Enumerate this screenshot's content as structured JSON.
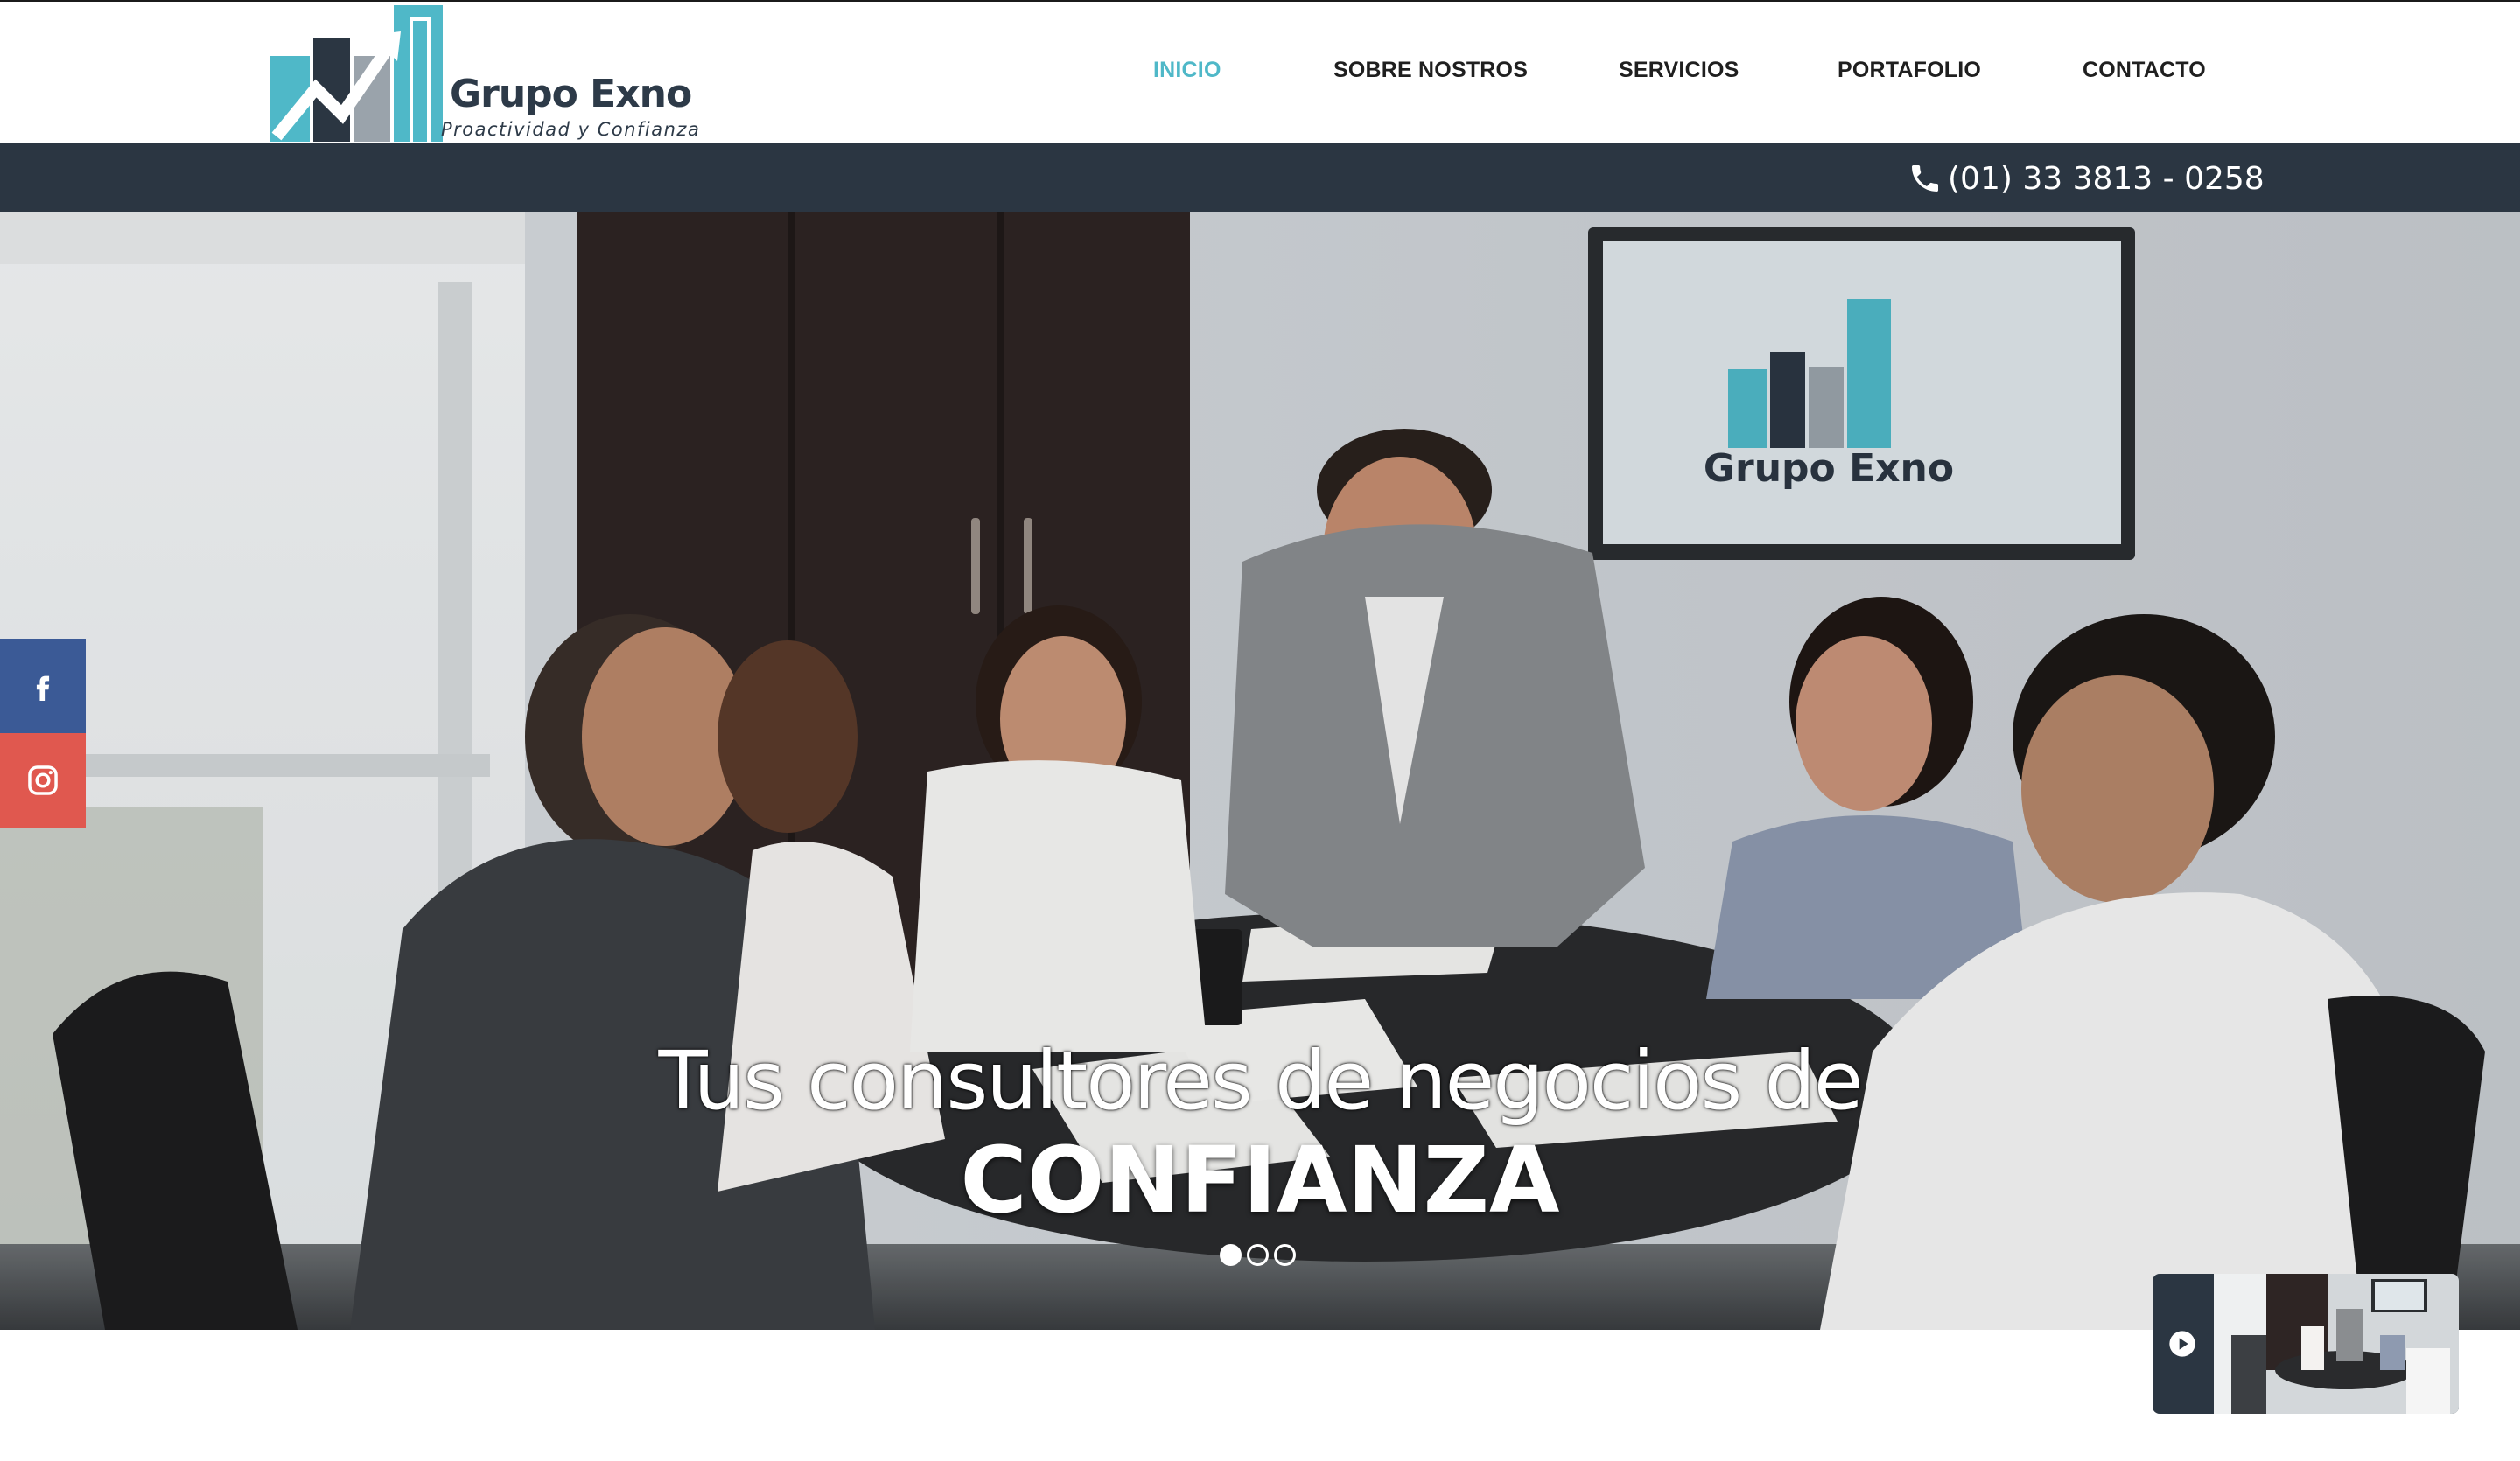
{
  "brand": {
    "name": "Grupo Exno",
    "tagline": "Proactividad y Confianza",
    "colors": {
      "teal": "#4fb8c8",
      "navy": "#2b3642",
      "gray": "#9aa3ab"
    }
  },
  "nav": {
    "items": [
      {
        "label": "INICIO",
        "active": true
      },
      {
        "label": "SOBRE NOSTROS",
        "active": false
      },
      {
        "label": "SERVICIOS",
        "active": false
      },
      {
        "label": "PORTAFOLIO",
        "active": false
      },
      {
        "label": "CONTACTO",
        "active": false
      }
    ]
  },
  "contact": {
    "phone": "(01) 33 3813 - 0258",
    "phone_icon": "phone-icon"
  },
  "hero": {
    "line1": "Tus consultores de negocios de",
    "line2": "CONFIANZA",
    "slide_count": 3,
    "active_slide": 1,
    "screen_logo_text": "Grupo Exno"
  },
  "social": [
    {
      "network": "facebook",
      "icon": "facebook-icon",
      "color": "#3b5a96"
    },
    {
      "network": "instagram",
      "icon": "instagram-icon",
      "color": "#e0584f"
    }
  ],
  "video": {
    "icon": "play-icon"
  }
}
